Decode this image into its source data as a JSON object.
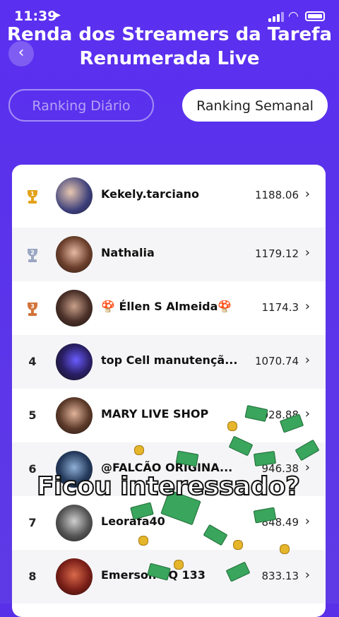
{
  "status": {
    "time": "11:39"
  },
  "header": {
    "title": "Renda dos Streamers da Tarefa Renumerada Live",
    "back_icon": "chevron-left-icon"
  },
  "tabs": [
    {
      "label": "Ranking Diário",
      "active": false
    },
    {
      "label": "Ranking Semanal",
      "active": true
    }
  ],
  "ranking": [
    {
      "rank": "1",
      "name": "Kekely.tarciano",
      "score": "1188.06"
    },
    {
      "rank": "2",
      "name": "Nathalia",
      "score": "1179.12"
    },
    {
      "rank": "3",
      "name": "🍄 Éllen S Almeida🍄",
      "score": "1174.3"
    },
    {
      "rank": "4",
      "name": "top Cell manutençã...",
      "score": "1070.74"
    },
    {
      "rank": "5",
      "name": "MARY LIVE SHOP",
      "score": "1028.88"
    },
    {
      "rank": "6",
      "name": "@FALCÃO ORIGINA...",
      "score": "946.38"
    },
    {
      "rank": "7",
      "name": "Leorafa40",
      "score": "848.49"
    },
    {
      "rank": "8",
      "name": "Emerson SQ 133",
      "score": "833.13"
    }
  ],
  "overlay": {
    "text": "Ficou interessado?"
  },
  "colors": {
    "gold": "#e3a21a",
    "silver": "#9aa6c2",
    "bronze": "#d2743b",
    "accent": "#5b2ff0"
  }
}
